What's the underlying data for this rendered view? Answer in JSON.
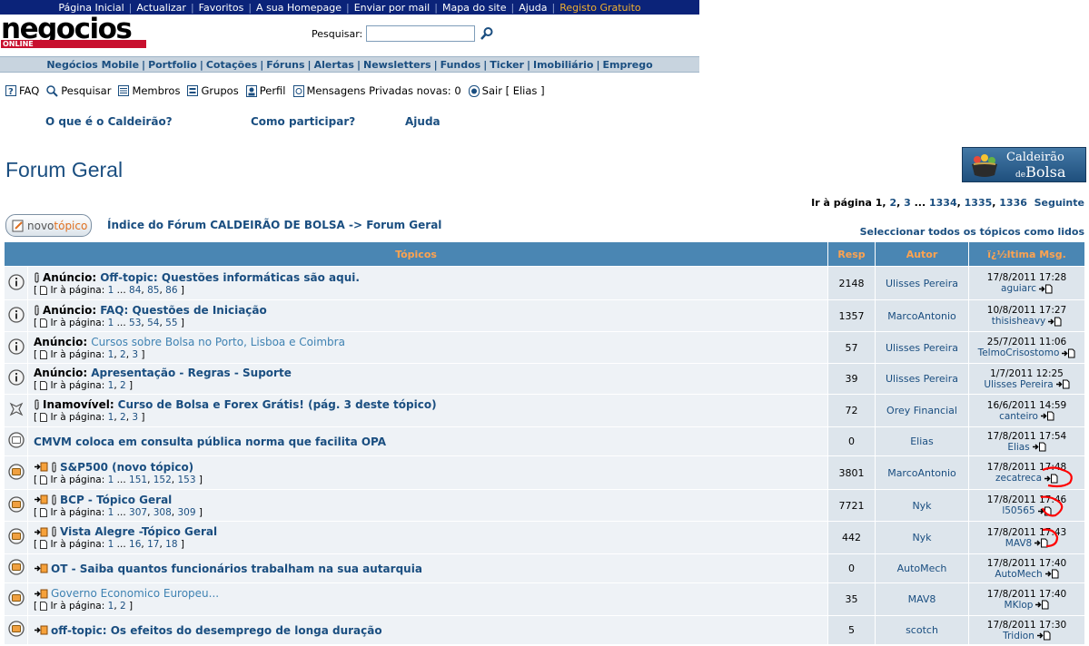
{
  "top_links": [
    {
      "label": "Página Inicial"
    },
    {
      "label": "Actualizar"
    },
    {
      "label": "Favoritos"
    },
    {
      "label": "A sua Homepage"
    },
    {
      "label": "Enviar por mail"
    },
    {
      "label": "Mapa do site"
    },
    {
      "label": "Ajuda"
    },
    {
      "label": "Registo Gratuito"
    }
  ],
  "logo": {
    "main": "negocios",
    "sub": "ONLINE"
  },
  "search": {
    "label": "Pesquisar:",
    "value": ""
  },
  "nav_links": [
    {
      "label": "Negócios Mobile"
    },
    {
      "label": "Portfolio"
    },
    {
      "label": "Cotações"
    },
    {
      "label": "Fóruns"
    },
    {
      "label": "Alertas"
    },
    {
      "label": "Newsletters"
    },
    {
      "label": "Fundos"
    },
    {
      "label": "Ticker"
    },
    {
      "label": "Imobiliário"
    },
    {
      "label": "Emprego"
    }
  ],
  "user_bar": {
    "faq": "FAQ",
    "search": "Pesquisar",
    "members": "Membros",
    "groups": "Grupos",
    "profile": "Perfil",
    "messages": "Mensagens Privadas novas: 0",
    "logout": "Sair [ Elias ]"
  },
  "info_links": {
    "what": "O que é o Caldeirão?",
    "how": "Como participar?",
    "help": "Ajuda"
  },
  "page_title": "Forum Geral",
  "brand_logo": {
    "line1": "Caldeirão",
    "de": "de",
    "bolsa": "Bolsa"
  },
  "pager": {
    "prefix": "Ir à página",
    "p1": "1",
    "p2": "2",
    "p3": "3",
    "ellipsis": "...",
    "p1334": "1334",
    "p1335": "1335",
    "p1336": "1336",
    "next": "Seguinte"
  },
  "new_topic": {
    "a": "novo",
    "b": "tópico"
  },
  "breadcrumb": {
    "index": "Índice do Fórum CALDEIRÃO DE BOLSA",
    "arrow": "->",
    "current": "Forum Geral"
  },
  "mark_read": "Seleccionar todos os tópicos como lidos",
  "table": {
    "headers": {
      "topics": "Tópicos",
      "replies": "Resp",
      "author": "Autor",
      "last": "ï¿½ltima Msg."
    },
    "pages_prefix": "Ir à página:",
    "rows": [
      {
        "prefix": "Anúncio:",
        "title": "Off-topic: Questões informáticas são aqui.",
        "pages": [
          "1",
          "...",
          "84",
          "85",
          "86"
        ],
        "replies": "2148",
        "author": "Ulisses Pereira",
        "last_date": "17/8/2011 17:28",
        "last_user": "aguiarc"
      },
      {
        "prefix": "Anúncio:",
        "title": "FAQ: Questões de Iniciação",
        "pages": [
          "1",
          "...",
          "53",
          "54",
          "55"
        ],
        "replies": "1357",
        "author": "MarcoAntonio",
        "last_date": "10/8/2011 17:27",
        "last_user": "thisisheavy"
      },
      {
        "prefix": "Anúncio:",
        "title": "Cursos sobre Bolsa no Porto, Lisboa e Coimbra",
        "pages": [
          "1",
          "2",
          "3"
        ],
        "replies": "57",
        "author": "Ulisses Pereira",
        "last_date": "25/7/2011 11:06",
        "last_user": "TelmoCrisostomo"
      },
      {
        "prefix": "Anúncio:",
        "title": "Apresentação - Regras - Suporte",
        "pages": [
          "1",
          "2"
        ],
        "replies": "39",
        "author": "Ulisses Pereira",
        "last_date": "1/7/2011 12:25",
        "last_user": "Ulisses Pereira"
      },
      {
        "prefix": "Inamovível:",
        "title": "Curso de Bolsa e Forex Grátis! (pág. 3 deste tópico)",
        "pages": [
          "1",
          "2",
          "3"
        ],
        "replies": "72",
        "author": "Orey Financial",
        "last_date": "16/6/2011 14:59",
        "last_user": "canteiro"
      },
      {
        "prefix": "",
        "title": "CMVM coloca em consulta pública norma que facilita OPA",
        "pages": [],
        "replies": "0",
        "author": "Elias",
        "last_date": "17/8/2011 17:54",
        "last_user": "Elias"
      },
      {
        "prefix": "",
        "title": "S&P500 (novo tópico)",
        "pages": [
          "1",
          "...",
          "151",
          "152",
          "153"
        ],
        "replies": "3801",
        "author": "MarcoAntonio",
        "last_date": "17/8/2011 17:48",
        "last_user": "zecatreca"
      },
      {
        "prefix": "",
        "title": "BCP - Tópico Geral",
        "pages": [
          "1",
          "...",
          "307",
          "308",
          "309"
        ],
        "replies": "7721",
        "author": "Nyk",
        "last_date": "17/8/2011 17:46",
        "last_user": "l50565"
      },
      {
        "prefix": "",
        "title": "Vista Alegre -Tópico Geral",
        "pages": [
          "1",
          "...",
          "16",
          "17",
          "18"
        ],
        "replies": "442",
        "author": "Nyk",
        "last_date": "17/8/2011 17:43",
        "last_user": "MAV8"
      },
      {
        "prefix": "",
        "title": "OT - Saiba quantos funcionários trabalham na sua autarquia",
        "pages": [],
        "replies": "0",
        "author": "AutoMech",
        "last_date": "17/8/2011 17:40",
        "last_user": "AutoMech"
      },
      {
        "prefix": "",
        "title": "Governo Economico Europeu...",
        "pages": [
          "1",
          "2"
        ],
        "replies": "35",
        "author": "MAV8",
        "last_date": "17/8/2011 17:40",
        "last_user": "MKlop"
      },
      {
        "prefix": "",
        "title": "off-topic: Os efeitos do desemprego de longa duração",
        "pages": [],
        "replies": "5",
        "author": "scotch",
        "last_date": "17/8/2011 17:30",
        "last_user": "Tridion"
      }
    ]
  }
}
